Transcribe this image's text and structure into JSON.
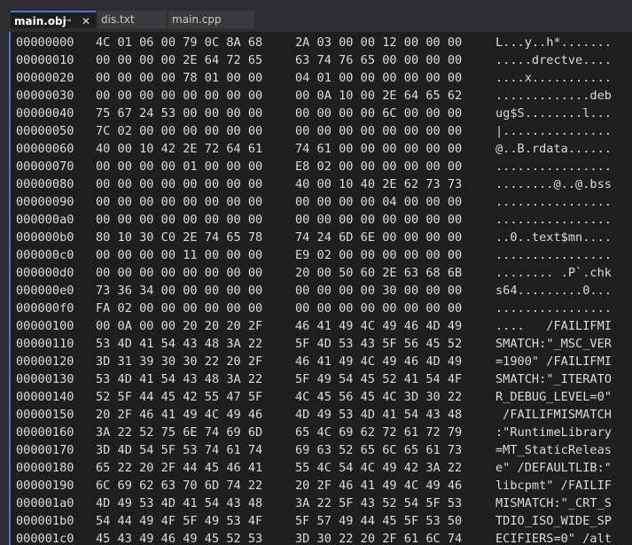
{
  "tabs": [
    {
      "label": "main.obj",
      "active": true
    },
    {
      "label": "dis.txt",
      "active": false
    },
    {
      "label": "main.cpp",
      "active": false
    }
  ],
  "tab_icons": {
    "pin": "⊸",
    "close": "✕"
  },
  "rows": [
    {
      "addr": "00000000",
      "hex1": "4C 01 06 00 79 0C 8A 68",
      "hex2": "2A 03 00 00 12 00 00 00",
      "ascii": "L...y..h*......."
    },
    {
      "addr": "00000010",
      "hex1": "00 00 00 00 2E 64 72 65",
      "hex2": "63 74 76 65 00 00 00 00",
      "ascii": ".....drectve...."
    },
    {
      "addr": "00000020",
      "hex1": "00 00 00 00 78 01 00 00",
      "hex2": "04 01 00 00 00 00 00 00",
      "ascii": "....x..........."
    },
    {
      "addr": "00000030",
      "hex1": "00 00 00 00 00 00 00 00",
      "hex2": "00 0A 10 00 2E 64 65 62",
      "ascii": ".............deb"
    },
    {
      "addr": "00000040",
      "hex1": "75 67 24 53 00 00 00 00",
      "hex2": "00 00 00 00 6C 00 00 00",
      "ascii": "ug$S........l..."
    },
    {
      "addr": "00000050",
      "hex1": "7C 02 00 00 00 00 00 00",
      "hex2": "00 00 00 00 00 00 00 00",
      "ascii": "|..............."
    },
    {
      "addr": "00000060",
      "hex1": "40 00 10 42 2E 72 64 61",
      "hex2": "74 61 00 00 00 00 00 00",
      "ascii": "@..B.rdata......"
    },
    {
      "addr": "00000070",
      "hex1": "00 00 00 00 01 00 00 00",
      "hex2": "E8 02 00 00 00 00 00 00",
      "ascii": "................"
    },
    {
      "addr": "00000080",
      "hex1": "00 00 00 00 00 00 00 00",
      "hex2": "40 00 10 40 2E 62 73 73",
      "ascii": "........@..@.bss"
    },
    {
      "addr": "00000090",
      "hex1": "00 00 00 00 00 00 00 00",
      "hex2": "00 00 00 00 04 00 00 00",
      "ascii": "................"
    },
    {
      "addr": "000000a0",
      "hex1": "00 00 00 00 00 00 00 00",
      "hex2": "00 00 00 00 00 00 00 00",
      "ascii": "................"
    },
    {
      "addr": "000000b0",
      "hex1": "80 10 30 C0 2E 74 65 78",
      "hex2": "74 24 6D 6E 00 00 00 00",
      "ascii": "..0..text$mn...."
    },
    {
      "addr": "000000c0",
      "hex1": "00 00 00 00 11 00 00 00",
      "hex2": "E9 02 00 00 00 00 00 00",
      "ascii": "................"
    },
    {
      "addr": "000000d0",
      "hex1": "00 00 00 00 00 00 00 00",
      "hex2": "20 00 50 60 2E 63 68 6B",
      "ascii": "........ .P`.chk"
    },
    {
      "addr": "000000e0",
      "hex1": "73 36 34 00 00 00 00 00",
      "hex2": "00 00 00 00 30 00 00 00",
      "ascii": "s64.........0..."
    },
    {
      "addr": "000000f0",
      "hex1": "FA 02 00 00 00 00 00 00",
      "hex2": "00 00 00 00 00 00 00 00",
      "ascii": "................"
    },
    {
      "addr": "00000100",
      "hex1": "00 0A 00 00 20 20 20 2F",
      "hex2": "46 41 49 4C 49 46 4D 49",
      "ascii": "....   /FAILIFMI"
    },
    {
      "addr": "00000110",
      "hex1": "53 4D 41 54 43 48 3A 22",
      "hex2": "5F 4D 53 43 5F 56 45 52",
      "ascii": "SMATCH:\"_MSC_VER"
    },
    {
      "addr": "00000120",
      "hex1": "3D 31 39 30 30 22 20 2F",
      "hex2": "46 41 49 4C 49 46 4D 49",
      "ascii": "=1900\" /FAILIFMI"
    },
    {
      "addr": "00000130",
      "hex1": "53 4D 41 54 43 48 3A 22",
      "hex2": "5F 49 54 45 52 41 54 4F",
      "ascii": "SMATCH:\"_ITERATO"
    },
    {
      "addr": "00000140",
      "hex1": "52 5F 44 45 42 55 47 5F",
      "hex2": "4C 45 56 45 4C 3D 30 22",
      "ascii": "R_DEBUG_LEVEL=0\""
    },
    {
      "addr": "00000150",
      "hex1": "20 2F 46 41 49 4C 49 46",
      "hex2": "4D 49 53 4D 41 54 43 48",
      "ascii": " /FAILIFMISMATCH"
    },
    {
      "addr": "00000160",
      "hex1": "3A 22 52 75 6E 74 69 6D",
      "hex2": "65 4C 69 62 72 61 72 79",
      "ascii": ":\"RuntimeLibrary"
    },
    {
      "addr": "00000170",
      "hex1": "3D 4D 54 5F 53 74 61 74",
      "hex2": "69 63 52 65 6C 65 61 73",
      "ascii": "=MT_StaticReleas"
    },
    {
      "addr": "00000180",
      "hex1": "65 22 20 2F 44 45 46 41",
      "hex2": "55 4C 54 4C 49 42 3A 22",
      "ascii": "e\" /DEFAULTLIB:\""
    },
    {
      "addr": "00000190",
      "hex1": "6C 69 62 63 70 6D 74 22",
      "hex2": "20 2F 46 41 49 4C 49 46",
      "ascii": "libcpmt\" /FAILIF"
    },
    {
      "addr": "000001a0",
      "hex1": "4D 49 53 4D 41 54 43 48",
      "hex2": "3A 22 5F 43 52 54 5F 53",
      "ascii": "MISMATCH:\"_CRT_S"
    },
    {
      "addr": "000001b0",
      "hex1": "54 44 49 4F 5F 49 53 4F",
      "hex2": "5F 57 49 44 45 5F 53 50",
      "ascii": "TDIO_ISO_WIDE_SP"
    },
    {
      "addr": "000001c0",
      "hex1": "45 43 49 46 49 45 52 53",
      "hex2": "3D 30 22 20 2F 61 6C 74",
      "ascii": "ECIFIERS=0\" /alt"
    }
  ]
}
